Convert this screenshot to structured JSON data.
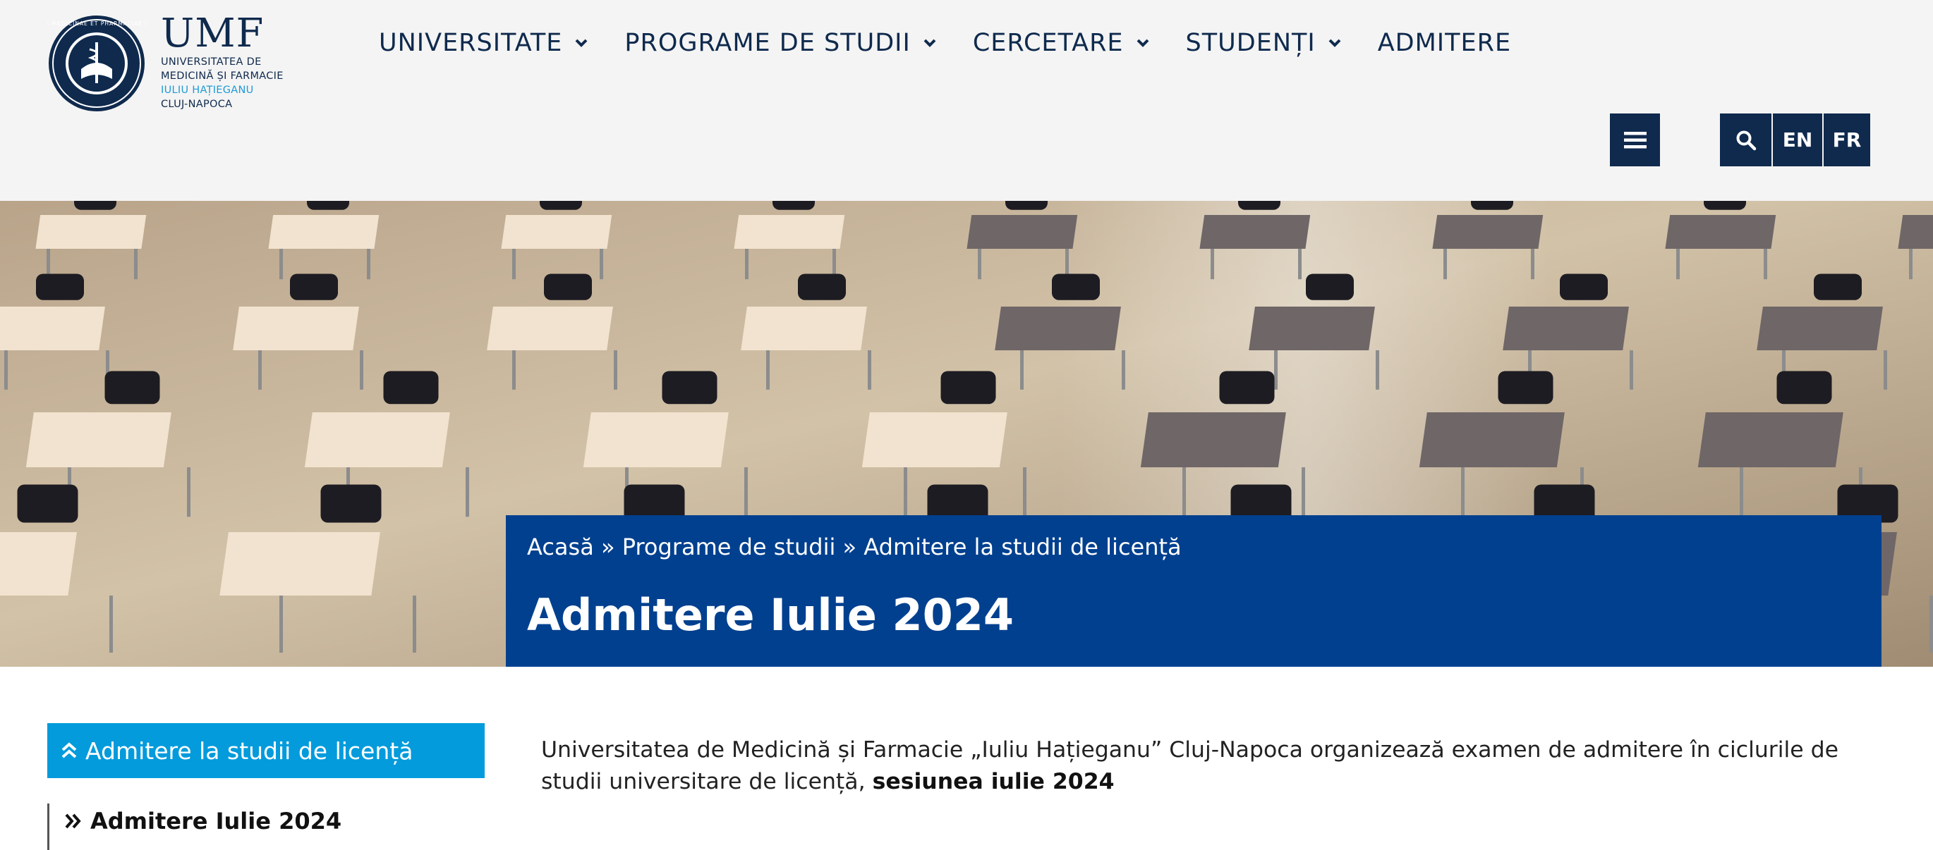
{
  "header": {
    "logo": {
      "abbr": "UMF",
      "line1": "UNIVERSITATEA DE",
      "line2": "MEDICINĂ ȘI FARMACIE",
      "line3": "IULIU HAȚIEGANU",
      "line4": "CLUJ-NAPOCA",
      "seal_text": "UNIVERSITAS MEDICINAE ET PHARMACIAE NAPOCENSIS"
    },
    "nav": [
      {
        "label": "UNIVERSITATE",
        "dropdown": true
      },
      {
        "label": "PROGRAME DE STUDII",
        "dropdown": true
      },
      {
        "label": "CERCETARE",
        "dropdown": true
      },
      {
        "label": "STUDENȚI",
        "dropdown": true
      },
      {
        "label": "ADMITERE",
        "dropdown": false
      }
    ],
    "controls": {
      "menu_icon": "hamburger-icon",
      "search_icon": "search-icon",
      "lang_en": "EN",
      "lang_fr": "FR"
    }
  },
  "hero": {
    "breadcrumb": {
      "home": "Acasă",
      "separator": "»",
      "section": "Programe de studii",
      "current": "Admitere la studii de licență"
    },
    "title": "Admitere Iulie 2024"
  },
  "sidebar": {
    "active_item": "Admitere la studii de licență",
    "sub_item": "Admitere Iulie 2024"
  },
  "content": {
    "intro_text": "Universitatea de Medicină și Farmacie „Iuliu Hațieganu” Cluj-Napoca organizează examen de admitere în ciclurile de studii universitare de licență,",
    "intro_bold": "sesiunea iulie 2024"
  },
  "colors": {
    "navy": "#0f2a4d",
    "banner_blue": "#01408f",
    "sidebar_blue": "#039bdc",
    "header_bg": "#f4f4f4"
  }
}
